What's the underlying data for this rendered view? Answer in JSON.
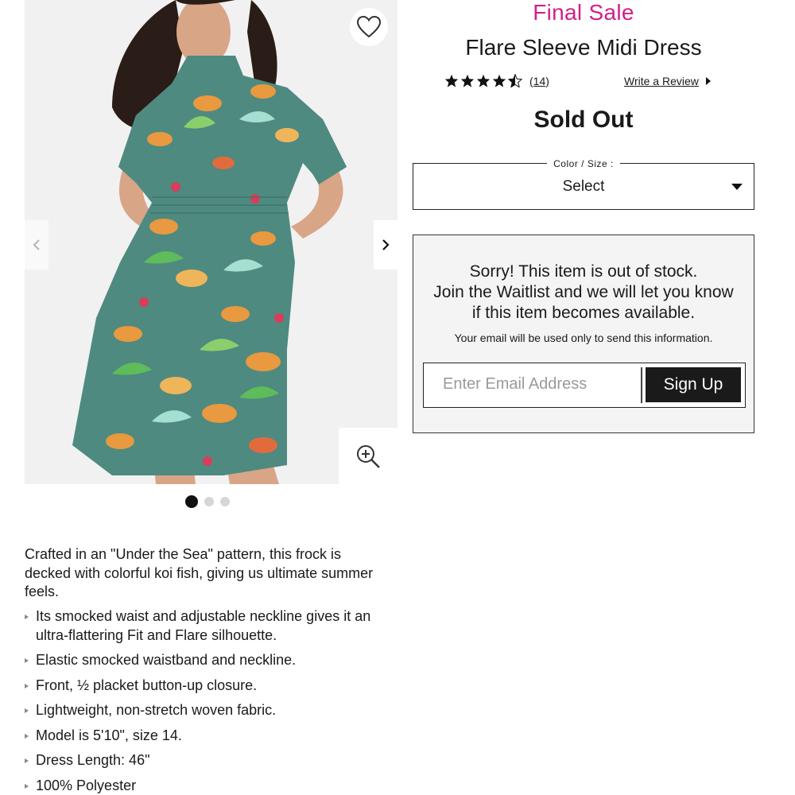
{
  "gallery": {
    "image_alt": "Model wearing teal koi-fish print flare sleeve midi dress",
    "wishlist_icon": "heart-outline-icon",
    "prev_icon": "chevron-left-icon",
    "next_icon": "chevron-right-icon",
    "zoom_icon": "zoom-in-icon",
    "dots_total": 3,
    "active_dot": 1
  },
  "product": {
    "sale_label": "Final Sale",
    "title": "Flare Sleeve Midi Dress",
    "rating": 4.5,
    "review_count": "(14)",
    "write_review": "Write a Review",
    "status": "Sold Out"
  },
  "selector": {
    "legend": "Color / Size :",
    "value": "Select"
  },
  "waitlist": {
    "line1": "Sorry! This item is out of stock.",
    "line2": "Join the Waitlist and we will let you know",
    "line3": "if this item becomes available.",
    "note": "Your email will be used only to send this information.",
    "email_placeholder": "Enter Email Address",
    "button": "Sign Up"
  },
  "description": {
    "intro": "Crafted in an \"Under the Sea\" pattern, this frock is decked with colorful koi fish, giving us ultimate summer feels.",
    "bullets": [
      "Its smocked waist and adjustable neckline gives it an ultra-flattering Fit and Flare silhouette.",
      "Elastic smocked waistband and neckline.",
      "Front, ½ placket button-up closure.",
      "Lightweight, non-stretch woven fabric.",
      "Model is 5'10\", size 14.",
      "Dress Length: 46\"",
      "100% Polyester"
    ]
  },
  "colors": {
    "sale_pink": "#d0208a",
    "dress_teal": "#4e8a80",
    "button_black": "#1a1a1a",
    "panel_gray": "#f4f4f4"
  }
}
